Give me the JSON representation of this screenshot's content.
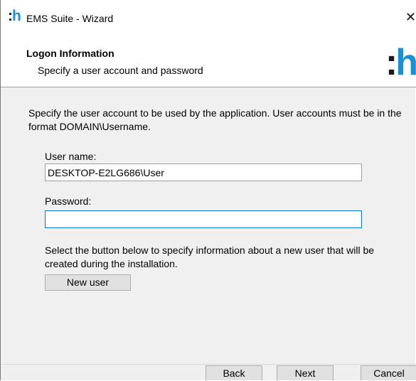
{
  "window": {
    "title": "EMS Suite - Wizard",
    "logo_colon": ":",
    "logo_letter": "h",
    "close_glyph": "✕"
  },
  "header": {
    "title": "Logon Information",
    "subtitle": "Specify a user account and password",
    "logo_colon": ":",
    "logo_letter": "h"
  },
  "content": {
    "intro": "Specify the user account to be used by the application. User accounts must be in the format DOMAIN\\Username.",
    "username_label": "User name:",
    "username_value": "DESKTOP-E2LG686\\User",
    "password_label": "Password:",
    "password_value": "",
    "new_user_info": "Select the button below to specify information about a new user that will be created during the installation.",
    "new_user_button": "New user"
  },
  "footer": {
    "back_label": "Back",
    "next_label": "Next",
    "cancel_label": "Cancel"
  },
  "colors": {
    "brand_blue": "#1a8fd6",
    "focus_border": "#0078d7",
    "dialog_background": "#f0f0f0"
  }
}
